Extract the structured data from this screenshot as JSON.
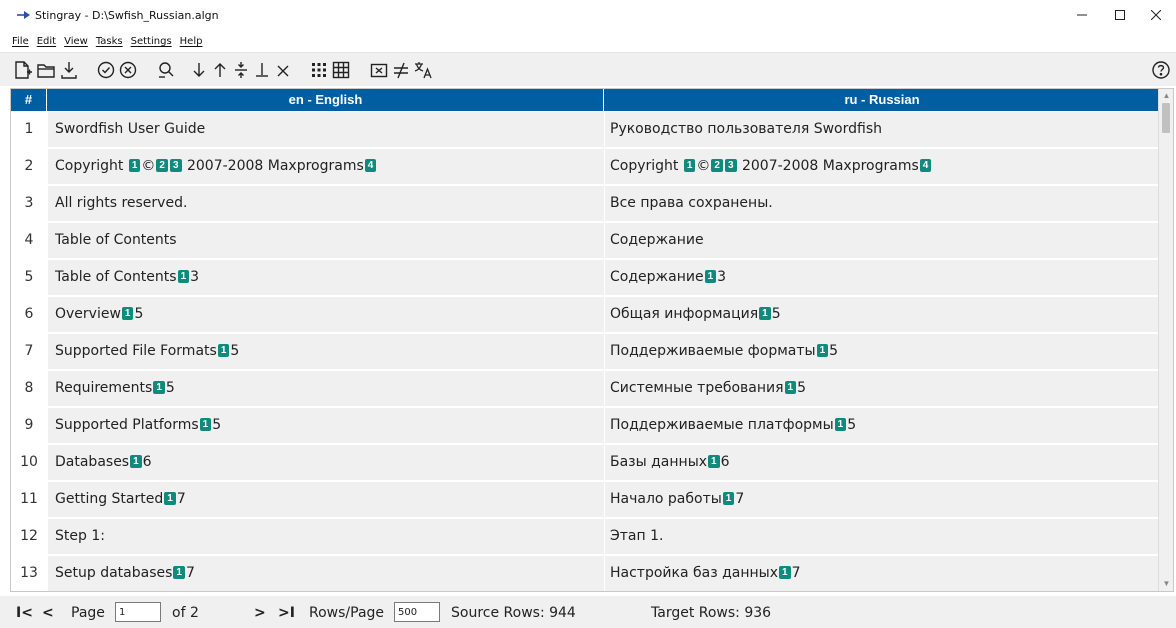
{
  "window": {
    "title": "Stingray - D:\\Swfish_Russian.algn",
    "controls": [
      "minimize",
      "maximize",
      "close"
    ]
  },
  "menu": [
    "File",
    "Edit",
    "View",
    "Tasks",
    "Settings",
    "Help"
  ],
  "toolbar_icons": [
    "new-file-icon",
    "open-folder-icon",
    "save-download-icon",
    "check-circle-icon",
    "x-circle-icon",
    "search-replace-icon",
    "arrow-down-icon",
    "arrow-up-icon",
    "split-icon",
    "merge-down-icon",
    "delete-icon",
    "grid-dots-icon",
    "grid-table-icon",
    "remove-tags-icon",
    "not-equal-icon",
    "translate-icon",
    "help-icon"
  ],
  "grid": {
    "headers": {
      "num": "#",
      "source": "en - English",
      "target": "ru - Russian"
    },
    "rows": [
      {
        "num": "1",
        "src": [
          {
            "t": "Swordfish User Guide"
          }
        ],
        "tgt": [
          {
            "t": "Руководство пользователя Swordfish"
          }
        ]
      },
      {
        "num": "2",
        "src": [
          {
            "t": "Copyright "
          },
          {
            "tag": "1"
          },
          {
            "t": "©"
          },
          {
            "tag": "2"
          },
          {
            "tag": "3"
          },
          {
            "t": " 2007-2008 Maxprograms"
          },
          {
            "tag": "4"
          }
        ],
        "tgt": [
          {
            "t": "Copyright "
          },
          {
            "tag": "1"
          },
          {
            "t": "©"
          },
          {
            "tag": "2"
          },
          {
            "tag": "3"
          },
          {
            "t": " 2007-2008 Maxprograms"
          },
          {
            "tag": "4"
          }
        ]
      },
      {
        "num": "3",
        "src": [
          {
            "t": "All rights reserved."
          }
        ],
        "tgt": [
          {
            "t": "Все права сохранены."
          }
        ]
      },
      {
        "num": "4",
        "src": [
          {
            "t": "Table of Contents"
          }
        ],
        "tgt": [
          {
            "t": "Содержание"
          }
        ]
      },
      {
        "num": "5",
        "src": [
          {
            "t": "Table of Contents"
          },
          {
            "tag": "1"
          },
          {
            "t": "3"
          }
        ],
        "tgt": [
          {
            "t": "Содержание"
          },
          {
            "tag": "1"
          },
          {
            "t": "3"
          }
        ]
      },
      {
        "num": "6",
        "src": [
          {
            "t": "Overview"
          },
          {
            "tag": "1"
          },
          {
            "t": "5"
          }
        ],
        "tgt": [
          {
            "t": "Общая информация"
          },
          {
            "tag": "1"
          },
          {
            "t": "5"
          }
        ]
      },
      {
        "num": "7",
        "src": [
          {
            "t": "Supported File Formats"
          },
          {
            "tag": "1"
          },
          {
            "t": "5"
          }
        ],
        "tgt": [
          {
            "t": "Поддерживаемые форматы"
          },
          {
            "tag": "1"
          },
          {
            "t": "5"
          }
        ]
      },
      {
        "num": "8",
        "src": [
          {
            "t": "Requirements"
          },
          {
            "tag": "1"
          },
          {
            "t": "5"
          }
        ],
        "tgt": [
          {
            "t": "Системные требования"
          },
          {
            "tag": "1"
          },
          {
            "t": "5"
          }
        ]
      },
      {
        "num": "9",
        "src": [
          {
            "t": "Supported Platforms"
          },
          {
            "tag": "1"
          },
          {
            "t": "5"
          }
        ],
        "tgt": [
          {
            "t": "Поддерживаемые платформы"
          },
          {
            "tag": "1"
          },
          {
            "t": "5"
          }
        ]
      },
      {
        "num": "10",
        "src": [
          {
            "t": "Databases"
          },
          {
            "tag": "1"
          },
          {
            "t": "6"
          }
        ],
        "tgt": [
          {
            "t": "Базы данных"
          },
          {
            "tag": "1"
          },
          {
            "t": "6"
          }
        ]
      },
      {
        "num": "11",
        "src": [
          {
            "t": "Getting Started"
          },
          {
            "tag": "1"
          },
          {
            "t": "7"
          }
        ],
        "tgt": [
          {
            "t": "Начало работы"
          },
          {
            "tag": "1"
          },
          {
            "t": "7"
          }
        ]
      },
      {
        "num": "12",
        "src": [
          {
            "t": "Step 1:"
          }
        ],
        "tgt": [
          {
            "t": "Этап 1."
          }
        ]
      },
      {
        "num": "13",
        "src": [
          {
            "t": "Setup databases"
          },
          {
            "tag": "1"
          },
          {
            "t": "7"
          }
        ],
        "tgt": [
          {
            "t": "Настройка баз данных"
          },
          {
            "tag": "1"
          },
          {
            "t": "7"
          }
        ]
      }
    ]
  },
  "status": {
    "first": "I<",
    "prev": "<",
    "page_label": "Page",
    "page_value": "1",
    "of_label": "of 2",
    "next": ">",
    "last": ">I",
    "rows_per_page_label": "Rows/Page",
    "rows_per_page_value": "500",
    "source_rows": "Source Rows: 944",
    "target_rows": "Target Rows: 936"
  },
  "colors": {
    "header_bg": "#005ea3",
    "tag_bg": "#118a7e",
    "cell_bg": "#f0f0f0"
  }
}
